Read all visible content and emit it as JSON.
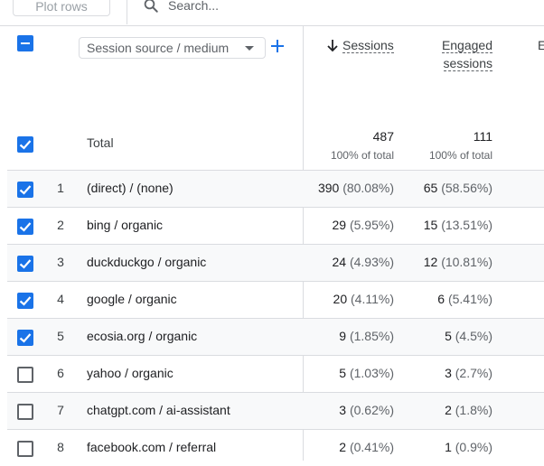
{
  "toolbar": {
    "plot_rows_label": "Plot rows",
    "search_placeholder": "Search..."
  },
  "header": {
    "dimension_label": "Session source / medium",
    "columns": [
      {
        "label_line1": "Sessions",
        "label_line2": "",
        "sorted": "descending"
      },
      {
        "label_line1": "Engaged",
        "label_line2": "sessions"
      },
      {
        "label_line1": "E"
      }
    ]
  },
  "totals": {
    "label": "Total",
    "sessions": "487",
    "sessions_pct": "100% of total",
    "engaged": "111",
    "engaged_pct": "100% of total"
  },
  "rows": [
    {
      "index": "1",
      "dimension": "(direct) / (none)",
      "sessions": "390",
      "sessions_pct": "(80.08%)",
      "engaged": "65",
      "engaged_pct": "(58.56%)",
      "checked": true
    },
    {
      "index": "2",
      "dimension": "bing / organic",
      "sessions": "29",
      "sessions_pct": "(5.95%)",
      "engaged": "15",
      "engaged_pct": "(13.51%)",
      "checked": true
    },
    {
      "index": "3",
      "dimension": "duckduckgo / organic",
      "sessions": "24",
      "sessions_pct": "(4.93%)",
      "engaged": "12",
      "engaged_pct": "(10.81%)",
      "checked": true
    },
    {
      "index": "4",
      "dimension": "google / organic",
      "sessions": "20",
      "sessions_pct": "(4.11%)",
      "engaged": "6",
      "engaged_pct": "(5.41%)",
      "checked": true
    },
    {
      "index": "5",
      "dimension": "ecosia.org / organic",
      "sessions": "9",
      "sessions_pct": "(1.85%)",
      "engaged": "5",
      "engaged_pct": "(4.5%)",
      "checked": true
    },
    {
      "index": "6",
      "dimension": "yahoo / organic",
      "sessions": "5",
      "sessions_pct": "(1.03%)",
      "engaged": "3",
      "engaged_pct": "(2.7%)",
      "checked": false
    },
    {
      "index": "7",
      "dimension": "chatgpt.com / ai-assistant",
      "sessions": "3",
      "sessions_pct": "(0.62%)",
      "engaged": "2",
      "engaged_pct": "(1.8%)",
      "checked": false
    },
    {
      "index": "8",
      "dimension": "facebook.com / referral",
      "sessions": "2",
      "sessions_pct": "(0.41%)",
      "engaged": "1",
      "engaged_pct": "(0.9%)",
      "checked": false
    }
  ],
  "colors": {
    "accent": "#1a73e8",
    "row_shade": "#f8f9fa",
    "divider": "#dadce0"
  }
}
